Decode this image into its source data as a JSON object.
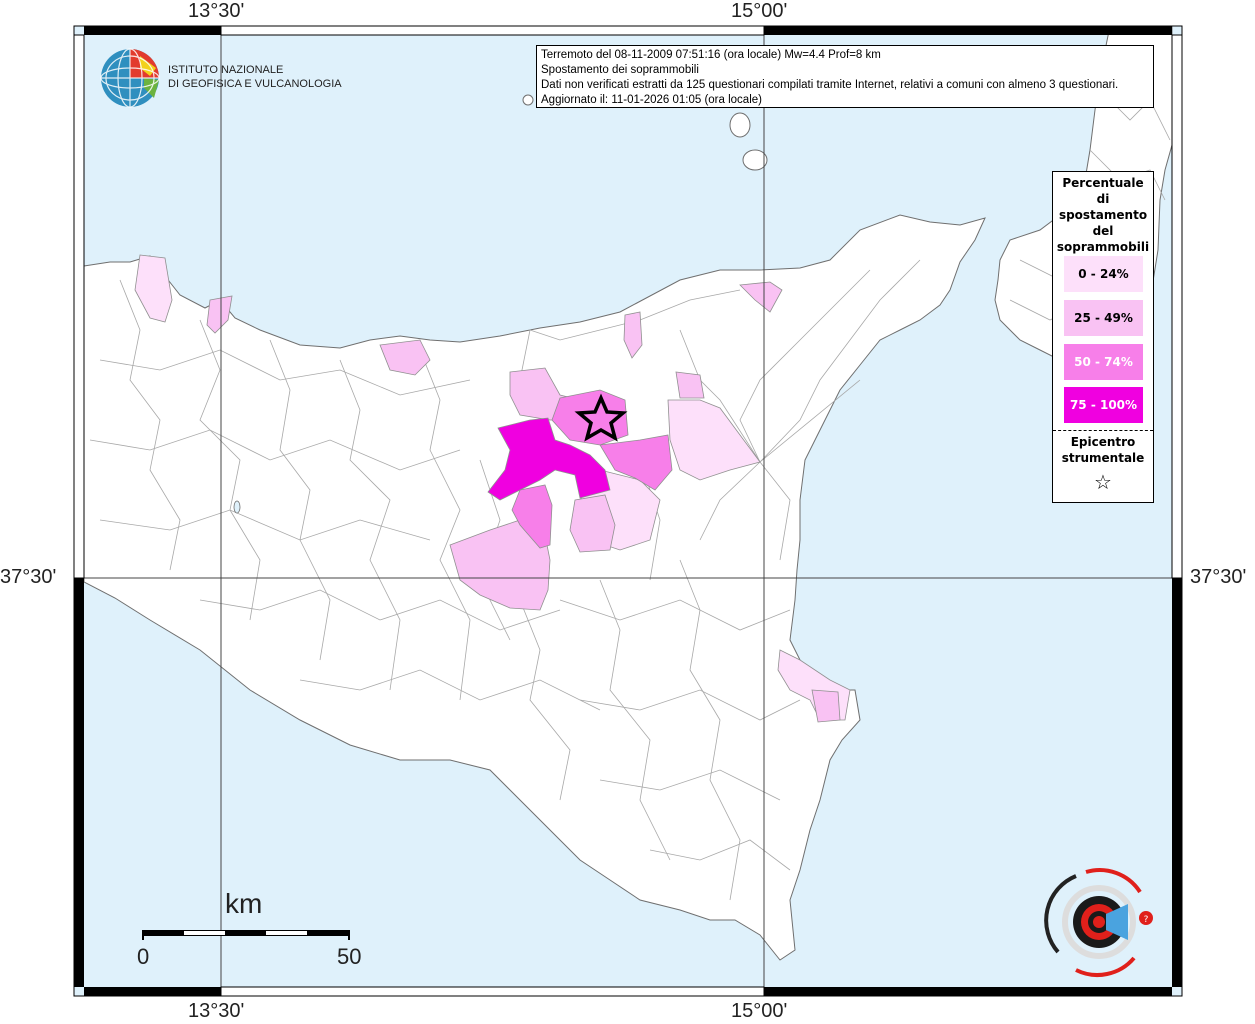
{
  "coords": {
    "lon_left": "13°30'",
    "lon_right": "15°00'",
    "lat": "37°30'"
  },
  "info": {
    "line1": "Terremoto del 08-11-2009 07:51:16 (ora locale) Mw=4.4 Prof=8 km",
    "line2": "Spostamento dei soprammobili",
    "line3": "Dati non verificati estratti da 125 questionari compilati tramite Internet, relativi a comuni con almeno 3 questionari.",
    "line4": "Aggiornato il: 11-01-2026 01:05 (ora locale)"
  },
  "logo": {
    "line1": "ISTITUTO NAZIONALE",
    "line2": "DI GEOFISICA E VULCANOLOGIA"
  },
  "legend": {
    "title_lines": [
      "Percentuale",
      "di",
      "spostamento",
      "del",
      "soprammobili"
    ],
    "items": [
      {
        "label": "0 - 24%",
        "color": "#fde0fa"
      },
      {
        "label": "25 - 49%",
        "color": "#f9c2f3"
      },
      {
        "label": "50 - 74%",
        "color": "#f77fe9"
      },
      {
        "label": "75 - 100%",
        "color": "#f000e0"
      }
    ],
    "epicenter_lines": [
      "Epicentro",
      "strumentale"
    ]
  },
  "scale": {
    "title": "km",
    "min": "0",
    "max": "50"
  },
  "colors": {
    "sea": "#dff1fb",
    "land": "#ffffff",
    "border": "#9a9a9a"
  }
}
